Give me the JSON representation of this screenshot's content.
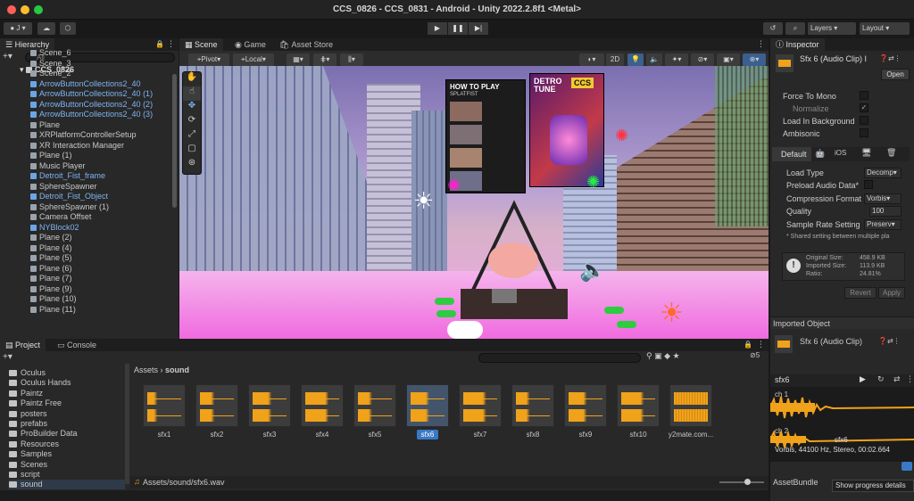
{
  "window": {
    "title": "CCS_0826 - CCS_0831 - Android - Unity 2022.2.8f1 <Metal>"
  },
  "toolbar": {
    "account": "J",
    "layers": "Layers",
    "layout": "Layout"
  },
  "hierarchy": {
    "tab": "Hierarchy",
    "search_placeholder": "All",
    "root": "CCS_0826",
    "items": [
      {
        "label": "Scene_6",
        "blue": false
      },
      {
        "label": "Scene_3",
        "blue": false
      },
      {
        "label": "Scene_2",
        "blue": false
      },
      {
        "label": "ArrowButtonCollections2_40",
        "blue": true
      },
      {
        "label": "ArrowButtonCollections2_40 (1)",
        "blue": true
      },
      {
        "label": "ArrowButtonCollections2_40 (2)",
        "blue": true
      },
      {
        "label": "ArrowButtonCollections2_40 (3)",
        "blue": true
      },
      {
        "label": "Plane",
        "blue": false
      },
      {
        "label": "XRPlatformControllerSetup",
        "blue": false
      },
      {
        "label": "XR Interaction Manager",
        "blue": false
      },
      {
        "label": "Plane (1)",
        "blue": false
      },
      {
        "label": "Music Player",
        "blue": false
      },
      {
        "label": "Detroit_Fist_frame",
        "blue": true
      },
      {
        "label": "SphereSpawner",
        "blue": false
      },
      {
        "label": "Detroit_Fist_Object",
        "blue": true
      },
      {
        "label": "SphereSpawner (1)",
        "blue": false
      },
      {
        "label": "Camera Offset",
        "blue": false
      },
      {
        "label": "NYBlock02",
        "blue": true
      },
      {
        "label": "Plane (2)",
        "blue": false
      },
      {
        "label": "Plane (4)",
        "blue": false
      },
      {
        "label": "Plane (5)",
        "blue": false
      },
      {
        "label": "Plane (6)",
        "blue": false
      },
      {
        "label": "Plane (7)",
        "blue": false
      },
      {
        "label": "Plane (9)",
        "blue": false
      },
      {
        "label": "Plane (10)",
        "blue": false
      },
      {
        "label": "Plane (11)",
        "blue": false
      }
    ]
  },
  "scene": {
    "tabs": [
      "Scene",
      "Game",
      "Asset Store"
    ],
    "pivot": "Pivot",
    "local": "Local",
    "mode_2d": "2D",
    "poster_left_title": "HOW TO PLAY",
    "poster_left_brand": "SPLATFIST",
    "poster_right_title": "DETRO TUNE",
    "poster_right_brand": "CCS"
  },
  "project": {
    "tabs": [
      "Project",
      "Console"
    ],
    "folders": [
      "Oculus",
      "Oculus Hands",
      "Paintz",
      "Paintz Free",
      "posters",
      "prefabs",
      "ProBuilder Data",
      "Resources",
      "Samples",
      "Scenes",
      "script",
      "sound"
    ],
    "breadcrumb": [
      "Assets",
      "sound"
    ],
    "count": "5",
    "assets": [
      "sfx1",
      "sfx2",
      "sfx3",
      "sfx4",
      "sfx5",
      "sfx6",
      "sfx7",
      "sfx8",
      "sfx9",
      "sfx10",
      "y2mate.com..."
    ],
    "selected_asset": "sfx6",
    "footer_path": "Assets/sound/sfx6.wav"
  },
  "inspector": {
    "tab": "Inspector",
    "asset_title": "Sfx 6 (Audio Clip) I",
    "open_button": "Open",
    "props": [
      "Force To Mono",
      "Normalize",
      "Load In Background",
      "Ambisonic"
    ],
    "platform_default": "Default",
    "platform_ios": "iOS",
    "load_type_label": "Load Type",
    "load_type_value": "Decomp",
    "preload_label": "Preload Audio Data*",
    "compression_label": "Compression Format",
    "compression_value": "Vorbis",
    "quality_label": "Quality",
    "quality_value": "100",
    "sample_rate_label": "Sample Rate Setting",
    "sample_rate_value": "Preserv",
    "shared_note": "* Shared setting between multiple pla",
    "original_size_label": "Original Size:",
    "original_size_value": "458.9 KB",
    "imported_size_label": "Imported Size:",
    "imported_size_value": "113.9 KB",
    "ratio_label": "Ratio:",
    "ratio_value": "24.81%",
    "revert": "Revert",
    "apply": "Apply",
    "imported_object": "Imported Object",
    "imported_clip": "Sfx 6 (Audio Clip)",
    "preview_name": "sfx6",
    "ch1": "ch 1",
    "ch2": "ch 2",
    "wave_title": "sfx6",
    "wave_info": "Vorbis, 44100 Hz, Stereo, 00:02.664",
    "asset_bundle": "AssetBundle",
    "progress_tooltip": "Show progress details"
  },
  "colors": {
    "accent": "#3a79c6",
    "wave": "#f0a21b",
    "blue_prefab": "#7fb4f0",
    "close": "#fe5f57",
    "minimize": "#febc2e",
    "maximize": "#28c840"
  }
}
